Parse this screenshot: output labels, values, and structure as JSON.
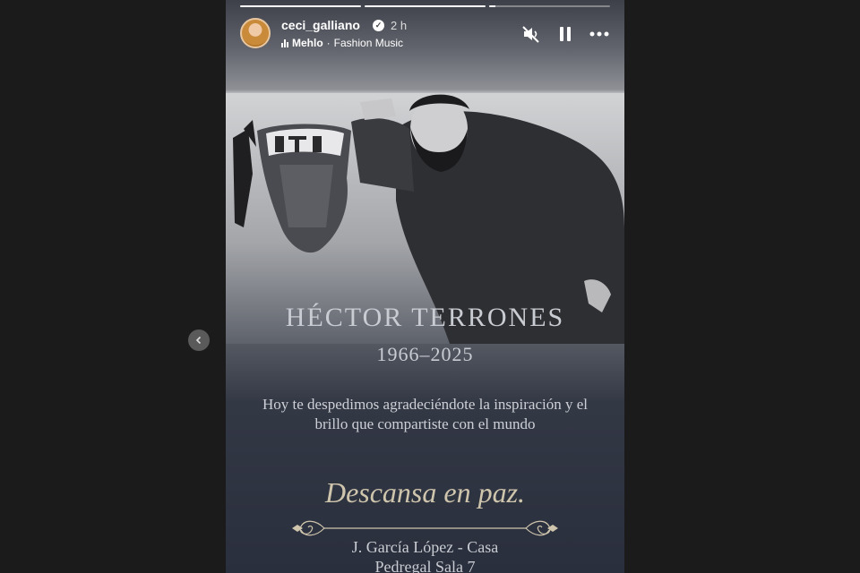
{
  "story": {
    "progress": [
      1.0,
      1.0,
      0.05
    ],
    "user": {
      "username": "ceci_galliano",
      "time": "2 h"
    },
    "music": {
      "song": "Mehlo",
      "separator": " · ",
      "artist": "Fashion Music"
    },
    "controls": [
      "mute-icon",
      "pause-icon",
      "more-icon"
    ]
  },
  "card": {
    "name": "HÉCTOR TERRONES",
    "years": "1966–2025",
    "message": "Hoy te despedimos agradeciéndote la inspiración y el brillo que compartiste con el mundo",
    "rip": "Descansa en paz.",
    "venue_line1": "J. García López - Casa",
    "venue_line2": "Pedregal Sala 7"
  },
  "colors": {
    "page_bg": "#1b1b1b",
    "card_text": "#c9ccd2",
    "script_text": "#cfc5ad"
  }
}
